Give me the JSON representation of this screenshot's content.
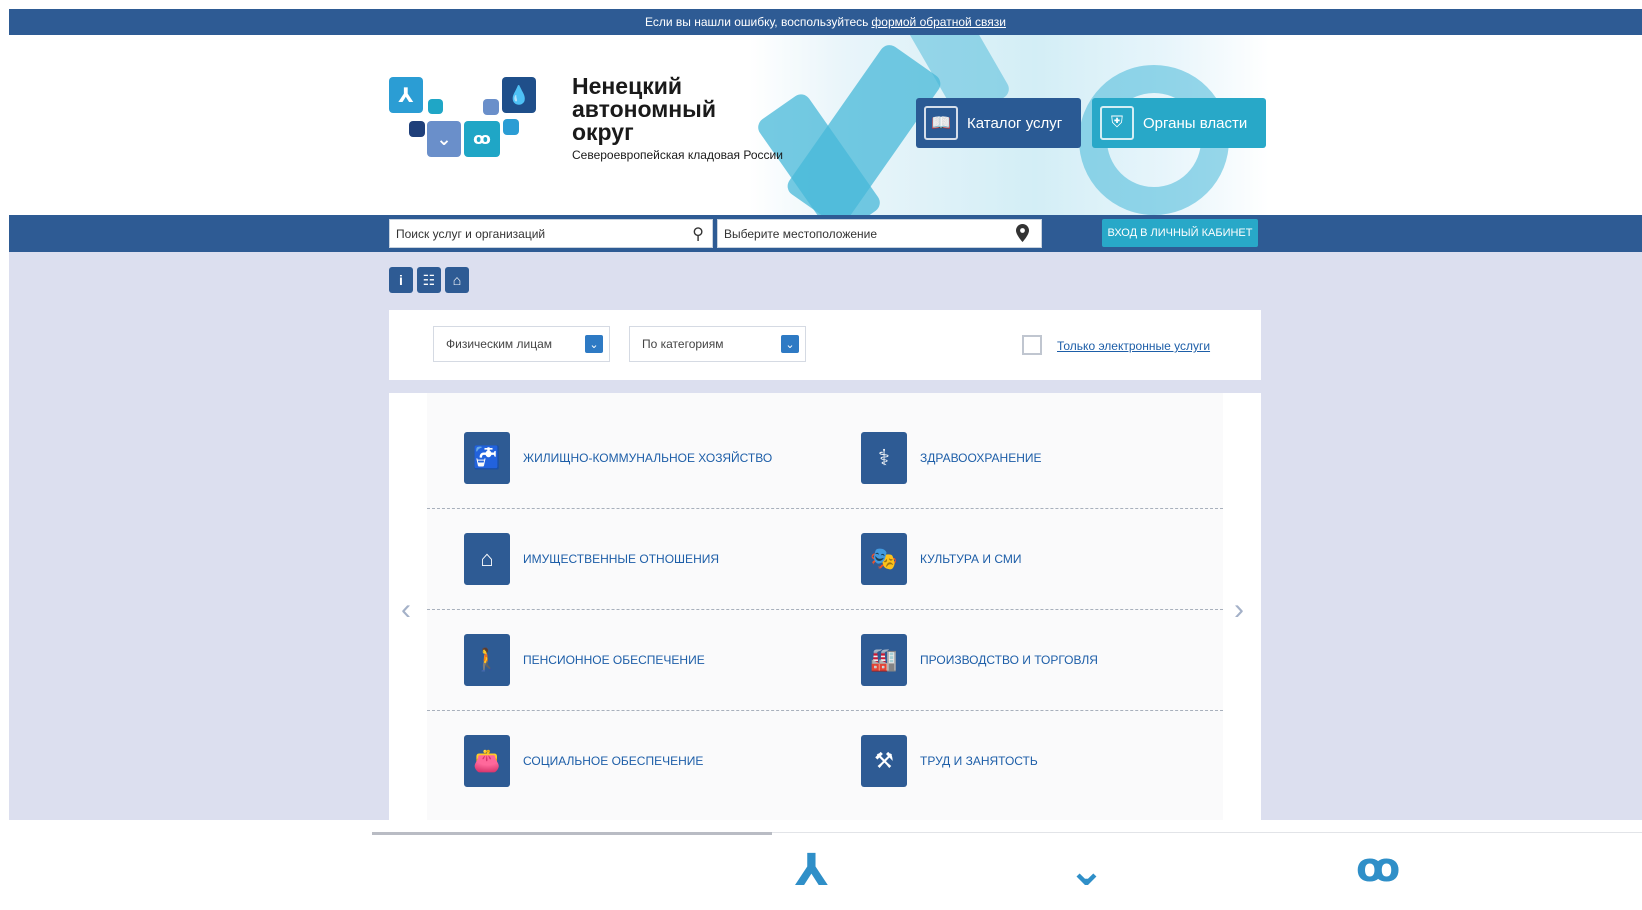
{
  "topbar": {
    "text": "Если вы нашли ошибку, воспользуйтесь",
    "link": "формой обратной связи"
  },
  "brand": {
    "title_line1": "Ненецкий",
    "title_line2": "автономный",
    "title_line3": "округ",
    "subtitle": "Североевропейская кладовая России"
  },
  "header_buttons": {
    "catalog": "Каталог услуг",
    "organs": "Органы власти"
  },
  "navbar": {
    "search_placeholder": "Поиск услуг и организаций",
    "location_placeholder": "Выберите местоположение",
    "login_label": "ВХОД В ЛИЧНЫЙ КАБИНЕТ"
  },
  "toolbar_icons": [
    "info-icon",
    "sitemap-icon",
    "home-icon"
  ],
  "filters": {
    "audience": "Физическим лицам",
    "grouping": "По категориям",
    "electronic_only": "Только электронные услуги"
  },
  "categories": [
    {
      "label": "ЖИЛИЩНО-КОММУНАЛЬНОЕ ХОЗЯЙСТВО",
      "icon": "faucet-icon"
    },
    {
      "label": "ЗДРАВООХРАНЕНИЕ",
      "icon": "medicine-bowl-icon"
    },
    {
      "label": "ИМУЩЕСТВЕННЫЕ ОТНОШЕНИЯ",
      "icon": "house-icon"
    },
    {
      "label": "КУЛЬТУРА И СМИ",
      "icon": "theater-masks-icon"
    },
    {
      "label": "ПЕНСИОННОЕ ОБЕСПЕЧЕНИЕ",
      "icon": "elderly-person-icon"
    },
    {
      "label": "ПРОИЗВОДСТВО И ТОРГОВЛЯ",
      "icon": "factory-icon"
    },
    {
      "label": "СОЦИАЛЬНОЕ ОБЕСПЕЧЕНИЕ",
      "icon": "purse-icon"
    },
    {
      "label": "ТРУД И ЗАНЯТОСТЬ",
      "icon": "tools-icon"
    }
  ],
  "colors": {
    "navy": "#2e5b94",
    "teal": "#28a8c8",
    "link": "#1d5ea8",
    "background": "#dcdfef"
  }
}
